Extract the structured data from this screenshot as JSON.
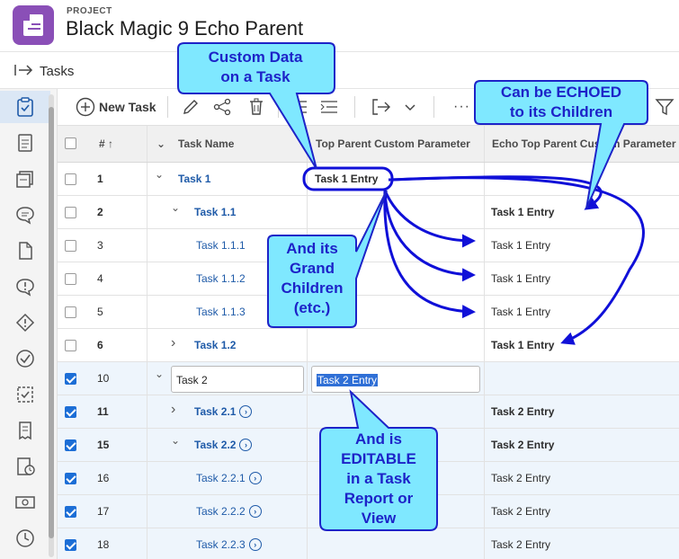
{
  "header": {
    "project_label": "PROJECT",
    "project_title": "Black Magic 9 Echo Parent"
  },
  "tabs_bar": {
    "title": "Tasks"
  },
  "sidebar": {
    "items": [
      "tasks-icon",
      "document-icon",
      "documents-stack-icon",
      "comment-icon",
      "file-icon",
      "issue-bubble-icon",
      "issue-diamond-icon",
      "approval-check-icon",
      "proof-icon",
      "receipt-icon",
      "timesheet-icon",
      "billing-icon",
      "clock-icon"
    ]
  },
  "toolbar": {
    "new_task_label": "New Task",
    "more_label": "···"
  },
  "table": {
    "columns": {
      "number": "#",
      "task_name": "Task Name",
      "top_parent": "Top Parent Custom Parameter",
      "echo": "Echo Top Parent Custom Parameter"
    },
    "rows": [
      {
        "num": "1",
        "name": "Task 1",
        "top": "Task 1 Entry",
        "echo": ""
      },
      {
        "num": "2",
        "name": "Task 1.1",
        "top": "",
        "echo": "Task 1 Entry"
      },
      {
        "num": "3",
        "name": "Task 1.1.1",
        "top": "",
        "echo": "Task 1 Entry"
      },
      {
        "num": "4",
        "name": "Task 1.1.2",
        "top": "",
        "echo": "Task 1 Entry"
      },
      {
        "num": "5",
        "name": "Task 1.1.3",
        "top": "",
        "echo": "Task 1 Entry"
      },
      {
        "num": "6",
        "name": "Task 1.2",
        "top": "",
        "echo": "Task 1 Entry"
      },
      {
        "num": "10",
        "name": "Task 2",
        "top": "Task 2 Entry",
        "echo": ""
      },
      {
        "num": "11",
        "name": "Task 2.1",
        "top": "",
        "echo": "Task 2 Entry"
      },
      {
        "num": "15",
        "name": "Task 2.2",
        "top": "",
        "echo": "Task 2 Entry"
      },
      {
        "num": "16",
        "name": "Task 2.2.1",
        "top": "",
        "echo": "Task 2 Entry"
      },
      {
        "num": "17",
        "name": "Task 2.2.2",
        "top": "",
        "echo": "Task 2 Entry"
      },
      {
        "num": "18",
        "name": "Task 2.2.3",
        "top": "",
        "echo": "Task 2 Entry"
      }
    ]
  },
  "callouts": {
    "custom_data": [
      "Custom Data",
      "on a Task"
    ],
    "echoed": [
      "Can be ECHOED",
      "to its Children"
    ],
    "grand_children": [
      "And its",
      "Grand",
      "Children",
      "(etc.)"
    ],
    "editable": [
      "And is",
      "EDITABLE",
      "in a Task",
      "Report or",
      "View"
    ]
  },
  "colors": {
    "callout_fill": "#7fe8ff",
    "callout_text": "#1d23c8",
    "arrow": "#1010d8",
    "link": "#1e5aa8",
    "check": "#1c6ed6"
  }
}
